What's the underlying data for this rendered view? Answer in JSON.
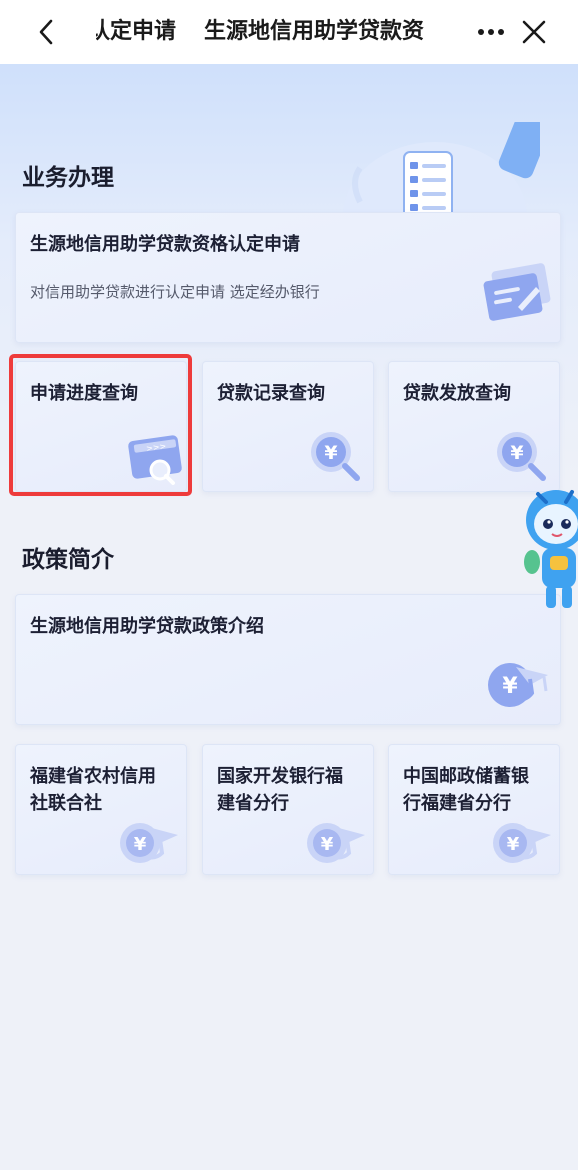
{
  "header": {
    "title_segments": [
      "认定申请",
      "生源地信用助学贷款资"
    ],
    "back_icon": "chevron-left-icon",
    "more_icon": "more-dots-icon",
    "close_icon": "close-icon"
  },
  "business": {
    "section_title": "业务办理",
    "main_card": {
      "title": "生源地信用助学贷款资格认定申请",
      "description": "对信用助学贷款进行认定申请 选定经办银行",
      "icon": "document-edit-icon"
    },
    "tiles": [
      {
        "label": "申请进度查询",
        "icon": "progress-search-icon"
      },
      {
        "label": "贷款记录查询",
        "icon": "yuan-search-icon"
      },
      {
        "label": "贷款发放查询",
        "icon": "yuan-search-icon"
      }
    ]
  },
  "policy": {
    "section_title": "政策简介",
    "main_card": {
      "title": "生源地信用助学贷款政策介绍",
      "icon": "yuan-graduation-icon"
    },
    "tiles": [
      {
        "label_line1": "福建省农村信用",
        "label_line2": "社联合社",
        "icon": "yuan-graduation-icon"
      },
      {
        "label_line1": "国家开发银行福",
        "label_line2": "建省分行",
        "icon": "yuan-graduation-icon"
      },
      {
        "label_line1": "中国邮政储蓄银",
        "label_line2": "行福建省分行",
        "icon": "yuan-graduation-icon"
      }
    ]
  },
  "colors": {
    "highlight_border": "#ee3b3b",
    "icon_primary": "#8fa6ef",
    "icon_light": "#c9d4f7"
  }
}
